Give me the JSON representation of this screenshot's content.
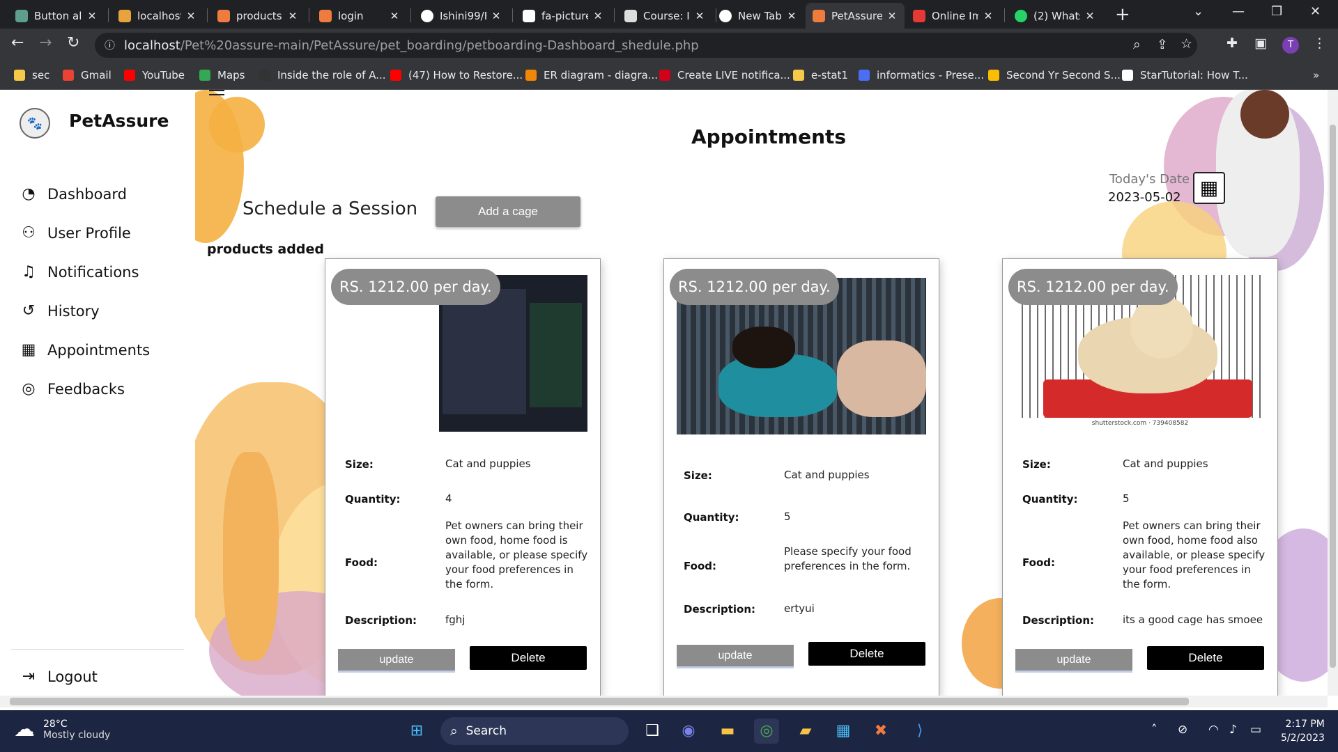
{
  "browser": {
    "tabs": [
      {
        "title": "Button al",
        "color": "#5e9e8f"
      },
      {
        "title": "localhost",
        "color": "#e8a33d"
      },
      {
        "title": "products",
        "color": "#f07b3f"
      },
      {
        "title": "login",
        "color": "#f07b3f"
      },
      {
        "title": "Ishini99/F",
        "color": "#ffffff"
      },
      {
        "title": "fa-picture",
        "color": "#ffffff"
      },
      {
        "title": "Course: IS",
        "color": "#dddddd"
      },
      {
        "title": "New Tab",
        "color": "#ffffff"
      },
      {
        "title": "PetAssure",
        "color": "#f07b3f"
      },
      {
        "title": "Online Im",
        "color": "#e53935"
      },
      {
        "title": "(2) Whats",
        "color": "#25d366"
      }
    ],
    "new_tab": "+",
    "url_host": "localhost",
    "url_path": "/Pet%20assure-main/PetAssure/pet_boarding/petboarding-Dashboard_shedule.php",
    "profile_initial": "T",
    "bookmarks": [
      {
        "label": "sec",
        "color": "#f7c948"
      },
      {
        "label": "Gmail",
        "color": "#ea4335"
      },
      {
        "label": "YouTube",
        "color": "#ff0000"
      },
      {
        "label": "Maps",
        "color": "#34a853"
      },
      {
        "label": "Inside the role of A...",
        "color": "#333333"
      },
      {
        "label": "(47) How to Restore...",
        "color": "#ff0000"
      },
      {
        "label": "ER diagram - diagra...",
        "color": "#f08705"
      },
      {
        "label": "Create LIVE notifica...",
        "color": "#d0021b"
      },
      {
        "label": "e-stat1",
        "color": "#f7c948"
      },
      {
        "label": "informatics - Prese...",
        "color": "#4c6ef5"
      },
      {
        "label": "Second Yr Second S...",
        "color": "#fbbc04"
      },
      {
        "label": "StarTutorial: How T...",
        "color": "#ffffff"
      }
    ],
    "more_bookmarks": "»"
  },
  "sidebar": {
    "brand": "PetAssure",
    "items": [
      {
        "label": "Dashboard",
        "icon": "dashboard-icon",
        "glyph": "◔"
      },
      {
        "label": "User Profile",
        "icon": "user-icon",
        "glyph": "👤"
      },
      {
        "label": "Notifications",
        "icon": "bell-icon",
        "glyph": "🔔"
      },
      {
        "label": "History",
        "icon": "history-icon",
        "glyph": "↺"
      },
      {
        "label": "Appointments",
        "icon": "calendar-icon",
        "glyph": "📅"
      },
      {
        "label": "Feedbacks",
        "icon": "feedback-icon",
        "glyph": "💬"
      }
    ],
    "logout": "Logout"
  },
  "main": {
    "title": "Appointments",
    "schedule_label": "Schedule a Session",
    "add_cage_button": "Add a cage",
    "products_label": "products added",
    "today_label": "Today's Date",
    "today_value": "2023-05-02"
  },
  "labels": {
    "size": "Size:",
    "quantity": "Quantity:",
    "food": "Food:",
    "description": "Description:",
    "update": "update",
    "delete": "Delete"
  },
  "cards": [
    {
      "price": "RS. 1212.00 per day.",
      "size": "Cat and puppies",
      "quantity": "4",
      "food": "Pet owners can bring their own food, home food is available, or please specify your food preferences in the form.",
      "description": "fghj",
      "image": "screenshot-image"
    },
    {
      "price": "RS. 1212.00 per day.",
      "size": "Cat and puppies",
      "quantity": "5",
      "food": "Please specify your food preferences in the form.",
      "description": "ertyui",
      "image": "dog-in-cage-photo"
    },
    {
      "price": "RS. 1212.00 per day.",
      "size": "Cat and puppies",
      "quantity": "5",
      "food": "Pet owners can bring their own food, home food also available, or please specify your food preferences in the form.",
      "description": "its a good cage has smoee",
      "image": "labrador-in-cage-photo",
      "image_caption": "shutterstock.com · 739408582"
    }
  ],
  "taskbar": {
    "temperature": "28°C",
    "weather": "Mostly cloudy",
    "search": "Search",
    "time": "2:17 PM",
    "date": "5/2/2023"
  }
}
